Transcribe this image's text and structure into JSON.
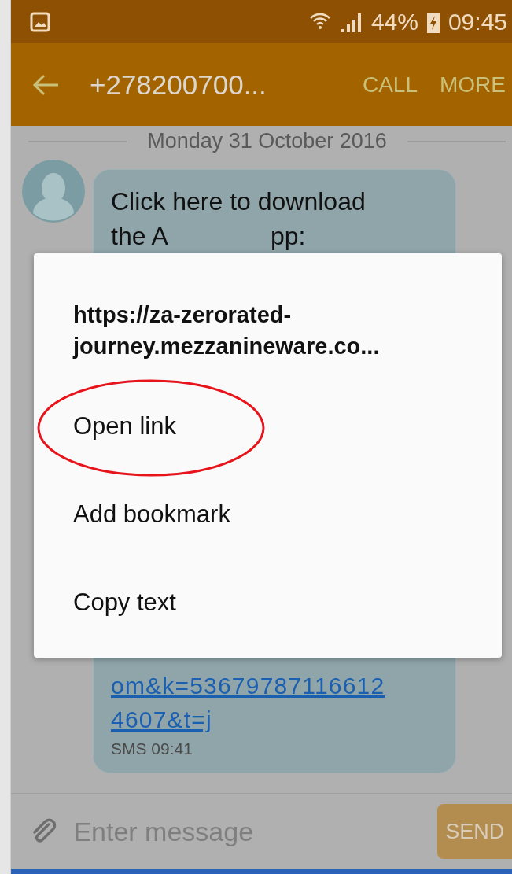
{
  "status_bar": {
    "battery": "44%",
    "time": "09:45"
  },
  "toolbar": {
    "title": "+278200700...",
    "actions": [
      "CALL",
      "MORE"
    ]
  },
  "conversation": {
    "date": "Monday 31 October 2016",
    "message": {
      "text_start": "Click here to download",
      "text_line2_start": "the A",
      "text_line2_end": "pp:",
      "link_lines": [
        "om&k=53679787116612",
        "4607&t=j"
      ],
      "meta": "SMS 09:41"
    }
  },
  "context_menu": {
    "title": "https://za-zerorated-journey.mezzanineware.co...",
    "items": [
      {
        "label": "Open link",
        "circled": true
      },
      {
        "label": "Add bookmark",
        "circled": false
      },
      {
        "label": "Copy text",
        "circled": false
      }
    ]
  },
  "composer": {
    "placeholder": "Enter message",
    "send": "SEND"
  }
}
